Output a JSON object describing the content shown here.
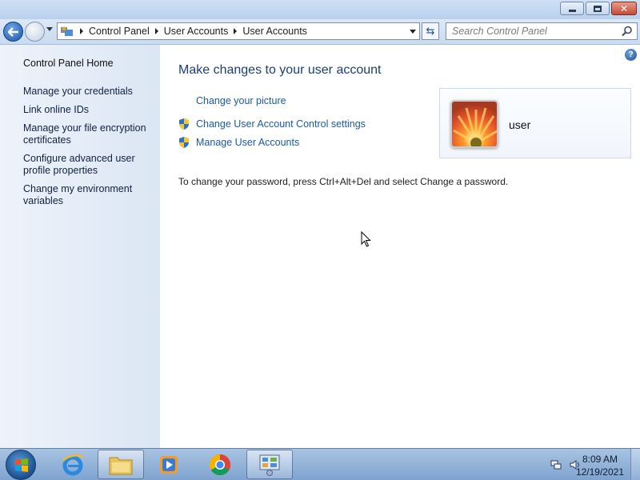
{
  "window": {
    "caption_buttons": [
      "minimize",
      "maximize",
      "close"
    ]
  },
  "navbar": {
    "breadcrumbs": [
      "Control Panel",
      "User Accounts",
      "User Accounts"
    ],
    "search_placeholder": "Search Control Panel"
  },
  "sidebar": {
    "home_label": "Control Panel Home",
    "tasks": [
      "Manage your credentials",
      "Link online IDs",
      "Manage your file encryption certificates",
      "Configure advanced user profile properties",
      "Change my environment variables"
    ]
  },
  "main": {
    "heading": "Make changes to your user account",
    "links": [
      "Change your picture",
      "Change User Account Control settings",
      "Manage User Accounts"
    ],
    "password_note": "To change your password, press Ctrl+Alt+Del and select Change a password.",
    "user_name": "user"
  },
  "taskbar": {
    "apps": [
      "internet-explorer",
      "windows-explorer",
      "windows-media-player",
      "google-chrome",
      "control-panel"
    ],
    "time": "8:09 AM",
    "date": "12/19/2021"
  },
  "colors": {
    "link": "#1b5aa4",
    "heading": "#1b3f73",
    "close_button": "#c54b36"
  }
}
